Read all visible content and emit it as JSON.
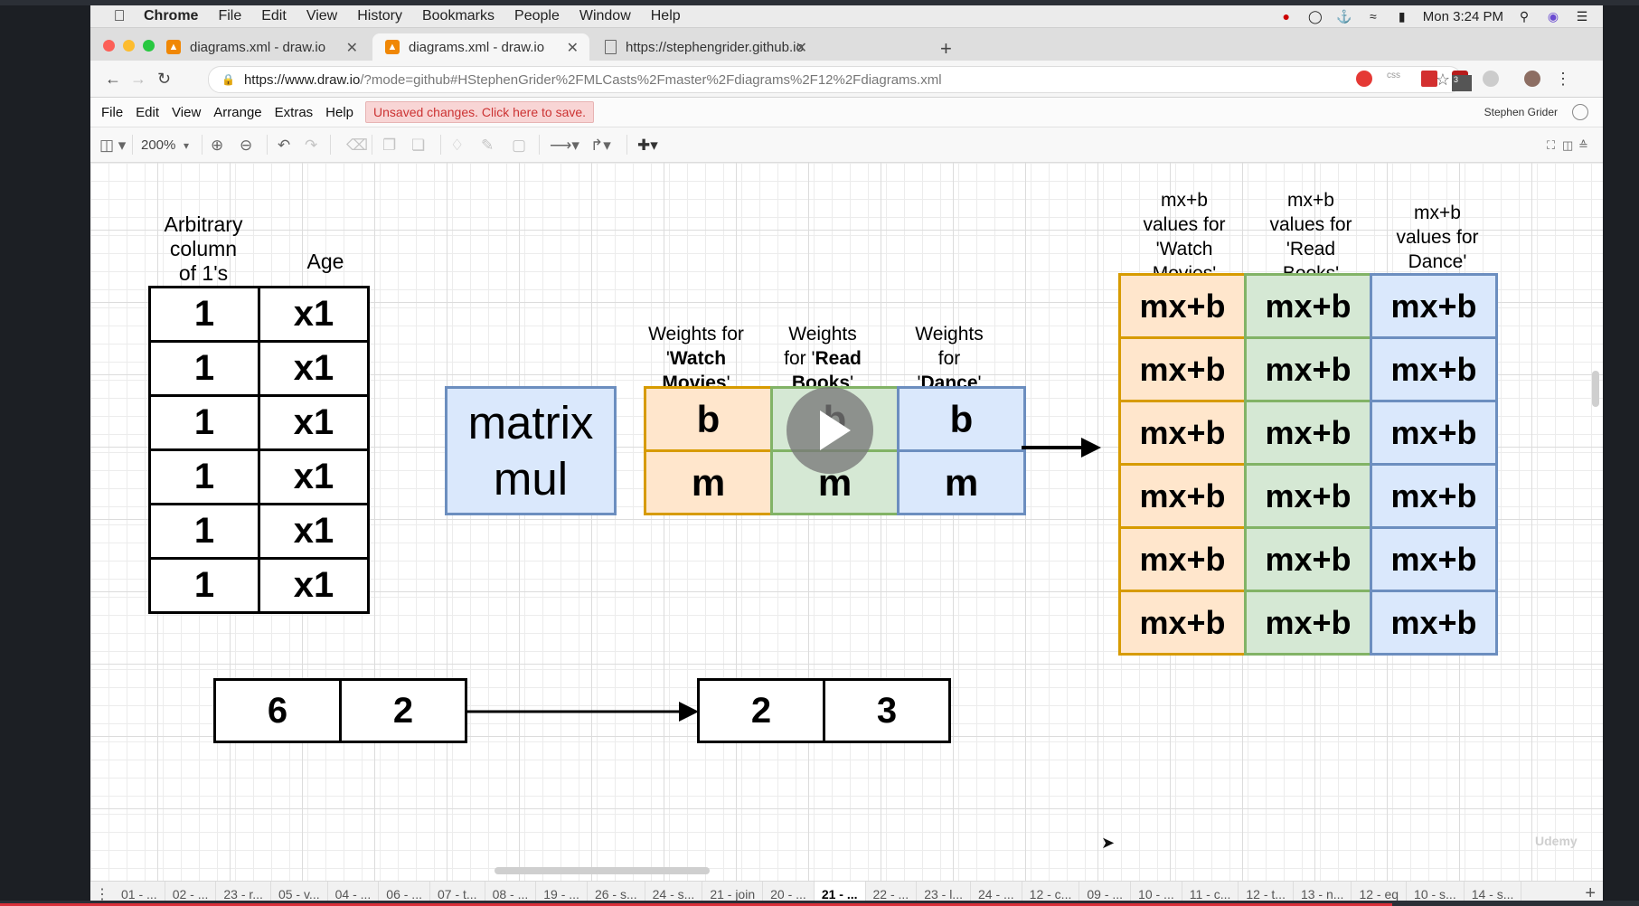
{
  "menubar": {
    "app": "Chrome",
    "items": [
      "File",
      "Edit",
      "View",
      "History",
      "Bookmarks",
      "People",
      "Window",
      "Help"
    ],
    "clock": "Mon 3:24 PM"
  },
  "tabs": [
    {
      "title": "diagrams.xml - draw.io"
    },
    {
      "title": "diagrams.xml - draw.io"
    },
    {
      "title": "https://stephengrider.github.io"
    }
  ],
  "address": {
    "url_host": "https://www.draw.io",
    "url_rest": "/?mode=github#HStephenGrider%2FMLCasts%2Fmaster%2Fdiagrams%2F12%2Fdiagrams.xml",
    "ext_badge": "3"
  },
  "drawio": {
    "menus": [
      "File",
      "Edit",
      "View",
      "Arrange",
      "Extras",
      "Help"
    ],
    "unsaved": "Unsaved changes. Click here to save.",
    "user": "Stephen Grider",
    "zoom": "200%"
  },
  "diagram": {
    "col1_label": "Arbitrary\ncolumn\nof 1's",
    "col2_label": "Age",
    "ones": [
      "1",
      "1",
      "1",
      "1",
      "1",
      "1"
    ],
    "ages": [
      "x1",
      "x1",
      "x1",
      "x1",
      "x1",
      "x1"
    ],
    "matmul": "matrix\nmul",
    "weights_labels": [
      {
        "pre": "Weights for\n'",
        "bold": "Watch\nMovies",
        "post": "'"
      },
      {
        "pre": "Weights\nfor '",
        "bold": "Read\nBooks",
        "post": "'"
      },
      {
        "pre": "Weights\nfor\n'",
        "bold": "Dance",
        "post": "'"
      }
    ],
    "weights_row1": [
      "b",
      "b",
      "b"
    ],
    "weights_row2": [
      "m",
      "m",
      "m"
    ],
    "result_labels": [
      "mx+b\nvalues for\n'Watch\nMovies'",
      "mx+b\nvalues for\n'Read\nBooks'",
      "mx+b\nvalues for\nDance'"
    ],
    "result_cell": "mx+b",
    "shape_left": [
      "6",
      "2"
    ],
    "shape_right": [
      "2",
      "3"
    ]
  },
  "pages": [
    "01 - ...",
    "02 - ...",
    "23 - r...",
    "05 - v...",
    "04 - ...",
    "06 - ...",
    "07 - t...",
    "08 - ...",
    "19 - ...",
    "26 - s...",
    "24 - s...",
    "21 - join",
    "20 - ...",
    "21 - ...",
    "22 - ...",
    "23 - l...",
    "24 - ...",
    "12 - c...",
    "09 - ...",
    "10 - ...",
    "11 - c...",
    "12 - t...",
    "13 - n...",
    "12 - eq",
    "10 - s...",
    "14 - s..."
  ],
  "active_page_index": 13,
  "watermark": "Udemy"
}
